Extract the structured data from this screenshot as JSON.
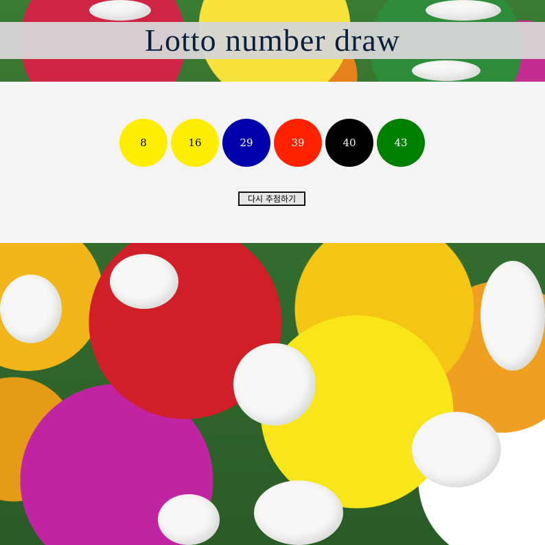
{
  "page": {
    "title": "Lotto number draw"
  },
  "draw": {
    "numbers": [
      {
        "value": "8",
        "color": "#ffee00",
        "text_color": "#000000"
      },
      {
        "value": "16",
        "color": "#ffee00",
        "text_color": "#000000"
      },
      {
        "value": "29",
        "color": "#0000aa",
        "text_color": "#ffffff"
      },
      {
        "value": "39",
        "color": "#ff2200",
        "text_color": "#ffffff"
      },
      {
        "value": "40",
        "color": "#000000",
        "text_color": "#ffffff"
      },
      {
        "value": "43",
        "color": "#008000",
        "text_color": "#ffffff"
      }
    ],
    "redraw_label": "다시 추첨하기"
  },
  "colors": {
    "title_bar": "#d6d6d6",
    "panel": "#f4f4f4",
    "title_text": "#0c1f3a"
  }
}
